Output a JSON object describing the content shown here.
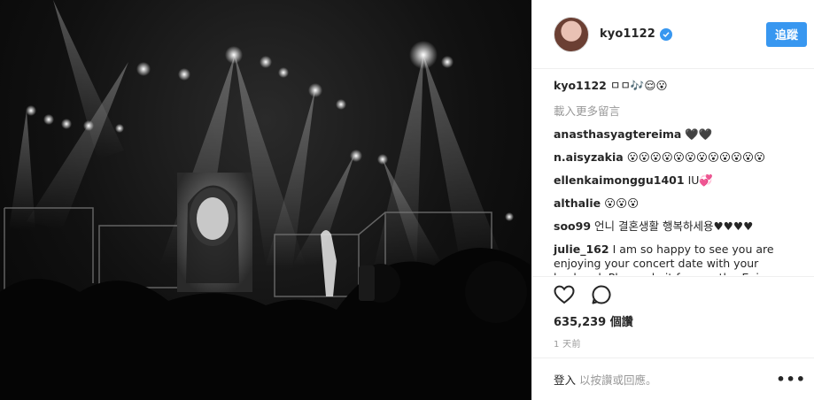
{
  "post": {
    "username": "kyo1122",
    "follow_label": "追蹤",
    "caption": "kyo1122 ㅁㅁ🎶😌😮",
    "caption_user": "kyo1122",
    "caption_text": "ㅁㅁ🎶😌😮",
    "load_more": "載入更多留言",
    "comments": [
      {
        "user": "anasthasyagtereima",
        "text": "🖤🖤"
      },
      {
        "user": "n.aisyzakia",
        "text": "😮😮😮😮😮😮😮😮😮😮😮😮"
      },
      {
        "user": "ellenkaimonggu1401",
        "text": "IU💞"
      },
      {
        "user": "althalie",
        "text": "😮😮😮"
      },
      {
        "user": "soo99",
        "text": "언니 결혼생활 행복하세용♥♥♥♥"
      },
      {
        "user": "julie_162",
        "text": "I am so happy to see you are enjoying your concert date with your husband. Please do it frequently.. Enjoy your"
      }
    ],
    "likes": "635,239 個讚",
    "time": "1 天前",
    "footer": {
      "login_link": "登入",
      "login_rest": "以按讚或回應。",
      "more": "•••"
    }
  },
  "icons": {
    "verified": "verified-badge-icon",
    "like": "heart-icon",
    "comment": "comment-bubble-icon",
    "more": "more-options-icon"
  },
  "colors": {
    "accent": "#3897f0",
    "text": "#262626",
    "muted": "#999999",
    "border": "#efefef"
  }
}
